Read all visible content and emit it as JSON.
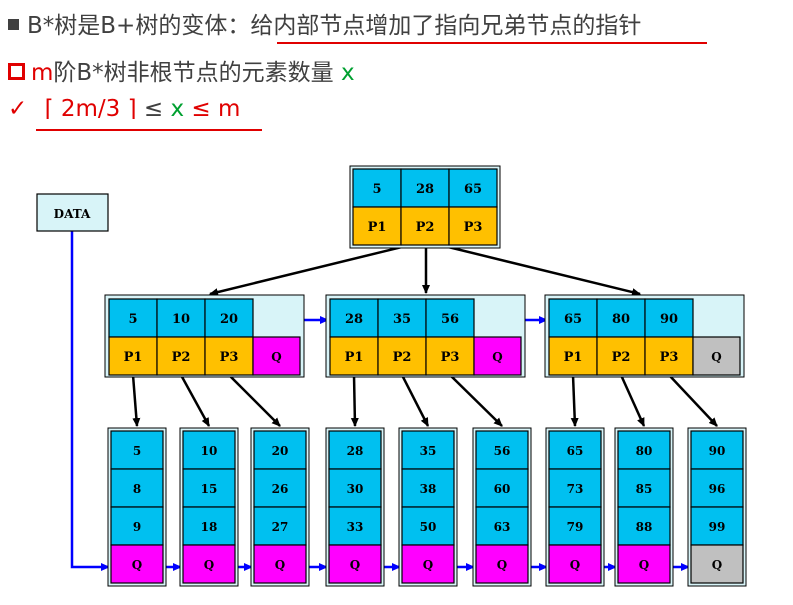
{
  "header": {
    "line1_prefix": "B*树是B+树的变体：",
    "line1_highlight": "给内部节点增加了指向兄弟节点的指针",
    "line2_m": "m",
    "line2_text": "阶B*树非根节点的元素数量",
    "line2_x": "x",
    "check_mark": "✓",
    "line3_formula": "⌈ 2m/3 ⌉",
    "line3_leq1": " ≤ ",
    "line3_x": "x",
    "line3_leq2": " ≤ m"
  },
  "diagram": {
    "data_label": "DATA",
    "root": {
      "keys": [
        "5",
        "28",
        "65"
      ],
      "pointers": [
        "P1",
        "P2",
        "P3"
      ]
    },
    "internal": [
      {
        "keys": [
          "5",
          "10",
          "20"
        ],
        "pointers": [
          "P1",
          "P2",
          "P3"
        ],
        "sibling": "Q",
        "sibling_color": "#ff00ff"
      },
      {
        "keys": [
          "28",
          "35",
          "56"
        ],
        "pointers": [
          "P1",
          "P2",
          "P3"
        ],
        "sibling": "Q",
        "sibling_color": "#ff00ff"
      },
      {
        "keys": [
          "65",
          "80",
          "90"
        ],
        "pointers": [
          "P1",
          "P2",
          "P3"
        ],
        "sibling": "Q",
        "sibling_color": "#c0c0c0"
      }
    ],
    "leaves": [
      {
        "keys": [
          "5",
          "8",
          "9"
        ],
        "link": "Q",
        "link_color": "#ff00ff"
      },
      {
        "keys": [
          "10",
          "15",
          "18"
        ],
        "link": "Q",
        "link_color": "#ff00ff"
      },
      {
        "keys": [
          "20",
          "26",
          "27"
        ],
        "link": "Q",
        "link_color": "#ff00ff"
      },
      {
        "keys": [
          "28",
          "30",
          "33"
        ],
        "link": "Q",
        "link_color": "#ff00ff"
      },
      {
        "keys": [
          "35",
          "38",
          "50"
        ],
        "link": "Q",
        "link_color": "#ff00ff"
      },
      {
        "keys": [
          "56",
          "60",
          "63"
        ],
        "link": "Q",
        "link_color": "#ff00ff"
      },
      {
        "keys": [
          "65",
          "73",
          "79"
        ],
        "link": "Q",
        "link_color": "#ff00ff"
      },
      {
        "keys": [
          "80",
          "85",
          "88"
        ],
        "link": "Q",
        "link_color": "#ff00ff"
      },
      {
        "keys": [
          "90",
          "96",
          "99"
        ],
        "link": "Q",
        "link_color": "#c0c0c0"
      }
    ],
    "colors": {
      "key_cell": "#00c0f0",
      "pointer_cell": "#ffc000",
      "node_bg": "#d8f4f8",
      "arrow_black": "#000000",
      "arrow_blue": "#0000ff"
    }
  }
}
